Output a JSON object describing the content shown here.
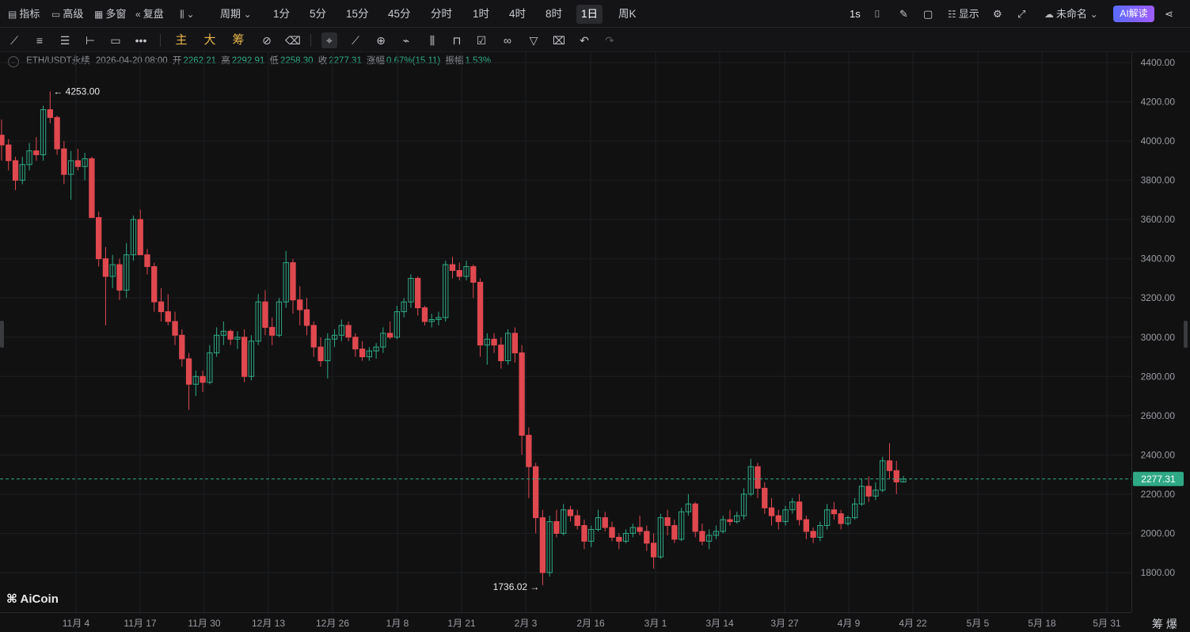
{
  "topbar": {
    "indicators": "指标",
    "advanced": "高级",
    "multiwindow": "多窗",
    "replay": "复盘",
    "period_label": "周期",
    "periods": [
      "1分",
      "5分",
      "15分",
      "45分",
      "分时",
      "1时",
      "4时",
      "8时",
      "1日",
      "周K"
    ],
    "active_period": "1日",
    "refresh": "1s",
    "display": "显示",
    "layout_name": "未命名",
    "ai_button": "AI解读"
  },
  "toolbar2": {
    "main": "主",
    "big": "大",
    "chips": "筹"
  },
  "info": {
    "symbol": "ETH/USDT永续",
    "datetime": "2026-04-20 08:00",
    "open_label": "开",
    "open": "2262.21",
    "high_label": "高",
    "high": "2292.91",
    "low_label": "低",
    "low": "2258.30",
    "close_label": "收",
    "close": "2277.31",
    "change_label": "涨幅",
    "change": "0.67%(15.11)",
    "amp_label": "振幅",
    "amp": "1.53%"
  },
  "chart_data": {
    "type": "candlestick",
    "yaxis_ticks": [
      "4400.00",
      "4200.00",
      "4000.00",
      "3800.00",
      "3600.00",
      "3400.00",
      "3200.00",
      "3000.00",
      "2800.00",
      "2600.00",
      "2400.00",
      "2200.00",
      "2000.00",
      "1800.00"
    ],
    "ylim": [
      1640,
      4460
    ],
    "xaxis_ticks": [
      "11月 4",
      "11月 17",
      "11月 30",
      "12月 13",
      "12月 26",
      "1月 8",
      "1月 21",
      "2月 3",
      "2月 16",
      "3月 1",
      "3月 14",
      "3月 27",
      "4月 9",
      "4月 22",
      "5月 5",
      "5月 18",
      "5月 31"
    ],
    "last_price": "2277.31",
    "max_label": "4253.00",
    "min_label": "1736.02",
    "grid": true,
    "colors": {
      "up": "#2fa985",
      "down": "#e0484f",
      "bg": "#111112"
    },
    "candles": [
      [
        4030,
        4110,
        3900,
        3980
      ],
      [
        3980,
        4010,
        3850,
        3900
      ],
      [
        3900,
        3920,
        3750,
        3800
      ],
      [
        3800,
        3920,
        3780,
        3880
      ],
      [
        3880,
        3990,
        3850,
        3950
      ],
      [
        3950,
        4020,
        3900,
        3930
      ],
      [
        3930,
        4180,
        3900,
        4160
      ],
      [
        4160,
        4253,
        4090,
        4120
      ],
      [
        4120,
        4130,
        3930,
        3960
      ],
      [
        3960,
        4000,
        3780,
        3830
      ],
      [
        3830,
        3950,
        3700,
        3900
      ],
      [
        3900,
        3960,
        3850,
        3870
      ],
      [
        3870,
        3940,
        3800,
        3910
      ],
      [
        3910,
        3920,
        3700,
        3610
      ],
      [
        3610,
        3640,
        3360,
        3400
      ],
      [
        3400,
        3460,
        3060,
        3310
      ],
      [
        3310,
        3420,
        3250,
        3370
      ],
      [
        3370,
        3400,
        3190,
        3240
      ],
      [
        3240,
        3480,
        3200,
        3420
      ],
      [
        3420,
        3620,
        3390,
        3600
      ],
      [
        3600,
        3650,
        3470,
        3420
      ],
      [
        3420,
        3450,
        3320,
        3360
      ],
      [
        3360,
        3380,
        3130,
        3180
      ],
      [
        3180,
        3250,
        3080,
        3130
      ],
      [
        3130,
        3220,
        3060,
        3080
      ],
      [
        3080,
        3130,
        2960,
        3010
      ],
      [
        3010,
        3040,
        2850,
        2890
      ],
      [
        2890,
        2920,
        2630,
        2760
      ],
      [
        2760,
        2830,
        2700,
        2800
      ],
      [
        2800,
        2830,
        2720,
        2770
      ],
      [
        2770,
        2960,
        2760,
        2920
      ],
      [
        2920,
        3050,
        2900,
        3010
      ],
      [
        3010,
        3080,
        2960,
        3030
      ],
      [
        3030,
        3040,
        2960,
        2990
      ],
      [
        2990,
        3030,
        2940,
        3000
      ],
      [
        3000,
        3040,
        2770,
        2800
      ],
      [
        2800,
        3010,
        2780,
        2980
      ],
      [
        2980,
        3220,
        2960,
        3180
      ],
      [
        3180,
        3240,
        3010,
        3050
      ],
      [
        3050,
        3100,
        2960,
        3010
      ],
      [
        3010,
        3200,
        3000,
        3180
      ],
      [
        3180,
        3440,
        3150,
        3380
      ],
      [
        3380,
        3400,
        3120,
        3190
      ],
      [
        3190,
        3260,
        3060,
        3140
      ],
      [
        3140,
        3200,
        3010,
        3060
      ],
      [
        3060,
        3080,
        2900,
        2950
      ],
      [
        2950,
        3000,
        2850,
        2880
      ],
      [
        2880,
        3020,
        2790,
        2990
      ],
      [
        2990,
        3040,
        2950,
        3010
      ],
      [
        3010,
        3090,
        2980,
        3060
      ],
      [
        3060,
        3080,
        2980,
        3000
      ],
      [
        3000,
        3020,
        2900,
        2940
      ],
      [
        2940,
        2980,
        2880,
        2900
      ],
      [
        2900,
        2950,
        2880,
        2930
      ],
      [
        2930,
        2970,
        2890,
        2950
      ],
      [
        2950,
        3050,
        2920,
        3020
      ],
      [
        3020,
        3080,
        2990,
        3000
      ],
      [
        3000,
        3160,
        2990,
        3130
      ],
      [
        3130,
        3200,
        3100,
        3180
      ],
      [
        3180,
        3320,
        3150,
        3300
      ],
      [
        3300,
        3310,
        3110,
        3150
      ],
      [
        3150,
        3160,
        3060,
        3080
      ],
      [
        3080,
        3120,
        3050,
        3090
      ],
      [
        3090,
        3130,
        3060,
        3100
      ],
      [
        3100,
        3390,
        3080,
        3370
      ],
      [
        3370,
        3410,
        3300,
        3340
      ],
      [
        3340,
        3380,
        3290,
        3310
      ],
      [
        3310,
        3390,
        3290,
        3360
      ],
      [
        3360,
        3370,
        3200,
        3280
      ],
      [
        3280,
        3300,
        2900,
        2960
      ],
      [
        2960,
        3020,
        2860,
        2990
      ],
      [
        2990,
        3020,
        2920,
        2960
      ],
      [
        2960,
        3000,
        2840,
        2880
      ],
      [
        2880,
        3040,
        2860,
        3020
      ],
      [
        3020,
        3050,
        2870,
        2920
      ],
      [
        2920,
        2960,
        2400,
        2500
      ],
      [
        2500,
        2540,
        2180,
        2340
      ],
      [
        2340,
        2360,
        2000,
        2080
      ],
      [
        2080,
        2120,
        1736,
        1800
      ],
      [
        1800,
        2090,
        1780,
        2060
      ],
      [
        2060,
        2120,
        1980,
        2000
      ],
      [
        2000,
        2150,
        1990,
        2120
      ],
      [
        2120,
        2140,
        2060,
        2090
      ],
      [
        2090,
        2120,
        2020,
        2040
      ],
      [
        2040,
        2070,
        1920,
        1960
      ],
      [
        1960,
        2040,
        1930,
        2020
      ],
      [
        2020,
        2120,
        2010,
        2080
      ],
      [
        2080,
        2110,
        2010,
        2030
      ],
      [
        2030,
        2060,
        1960,
        1980
      ],
      [
        1980,
        2000,
        1920,
        1960
      ],
      [
        1960,
        2020,
        1950,
        2000
      ],
      [
        2000,
        2050,
        1980,
        2030
      ],
      [
        2030,
        2090,
        1990,
        2010
      ],
      [
        2010,
        2040,
        1910,
        1950
      ],
      [
        1950,
        2000,
        1820,
        1880
      ],
      [
        1880,
        2100,
        1870,
        2080
      ],
      [
        2080,
        2120,
        1990,
        2040
      ],
      [
        2040,
        2070,
        1950,
        1970
      ],
      [
        1970,
        2130,
        1960,
        2110
      ],
      [
        2110,
        2200,
        2090,
        2150
      ],
      [
        2150,
        2160,
        1980,
        2010
      ],
      [
        2010,
        2050,
        1940,
        1960
      ],
      [
        1960,
        2020,
        1920,
        1990
      ],
      [
        1990,
        2040,
        1970,
        2010
      ],
      [
        2010,
        2090,
        2000,
        2070
      ],
      [
        2070,
        2120,
        2040,
        2060
      ],
      [
        2060,
        2110,
        2050,
        2090
      ],
      [
        2090,
        2230,
        2070,
        2200
      ],
      [
        2200,
        2380,
        2190,
        2340
      ],
      [
        2340,
        2360,
        2180,
        2230
      ],
      [
        2230,
        2260,
        2100,
        2130
      ],
      [
        2130,
        2180,
        2040,
        2090
      ],
      [
        2090,
        2120,
        2020,
        2060
      ],
      [
        2060,
        2140,
        2040,
        2120
      ],
      [
        2120,
        2180,
        2100,
        2160
      ],
      [
        2160,
        2200,
        2040,
        2070
      ],
      [
        2070,
        2090,
        1970,
        2010
      ],
      [
        2010,
        2030,
        1950,
        1980
      ],
      [
        1980,
        2060,
        1960,
        2040
      ],
      [
        2040,
        2150,
        2020,
        2120
      ],
      [
        2120,
        2160,
        2070,
        2100
      ],
      [
        2100,
        2120,
        2020,
        2050
      ],
      [
        2050,
        2090,
        2040,
        2080
      ],
      [
        2080,
        2180,
        2070,
        2150
      ],
      [
        2150,
        2280,
        2140,
        2240
      ],
      [
        2240,
        2290,
        2160,
        2190
      ],
      [
        2190,
        2260,
        2170,
        2220
      ],
      [
        2220,
        2390,
        2210,
        2370
      ],
      [
        2370,
        2460,
        2280,
        2320
      ],
      [
        2320,
        2370,
        2200,
        2262
      ],
      [
        2262,
        2293,
        2258,
        2277
      ]
    ]
  },
  "brand": {
    "logo": "AiCoin",
    "corner_text": "筹 爆"
  }
}
